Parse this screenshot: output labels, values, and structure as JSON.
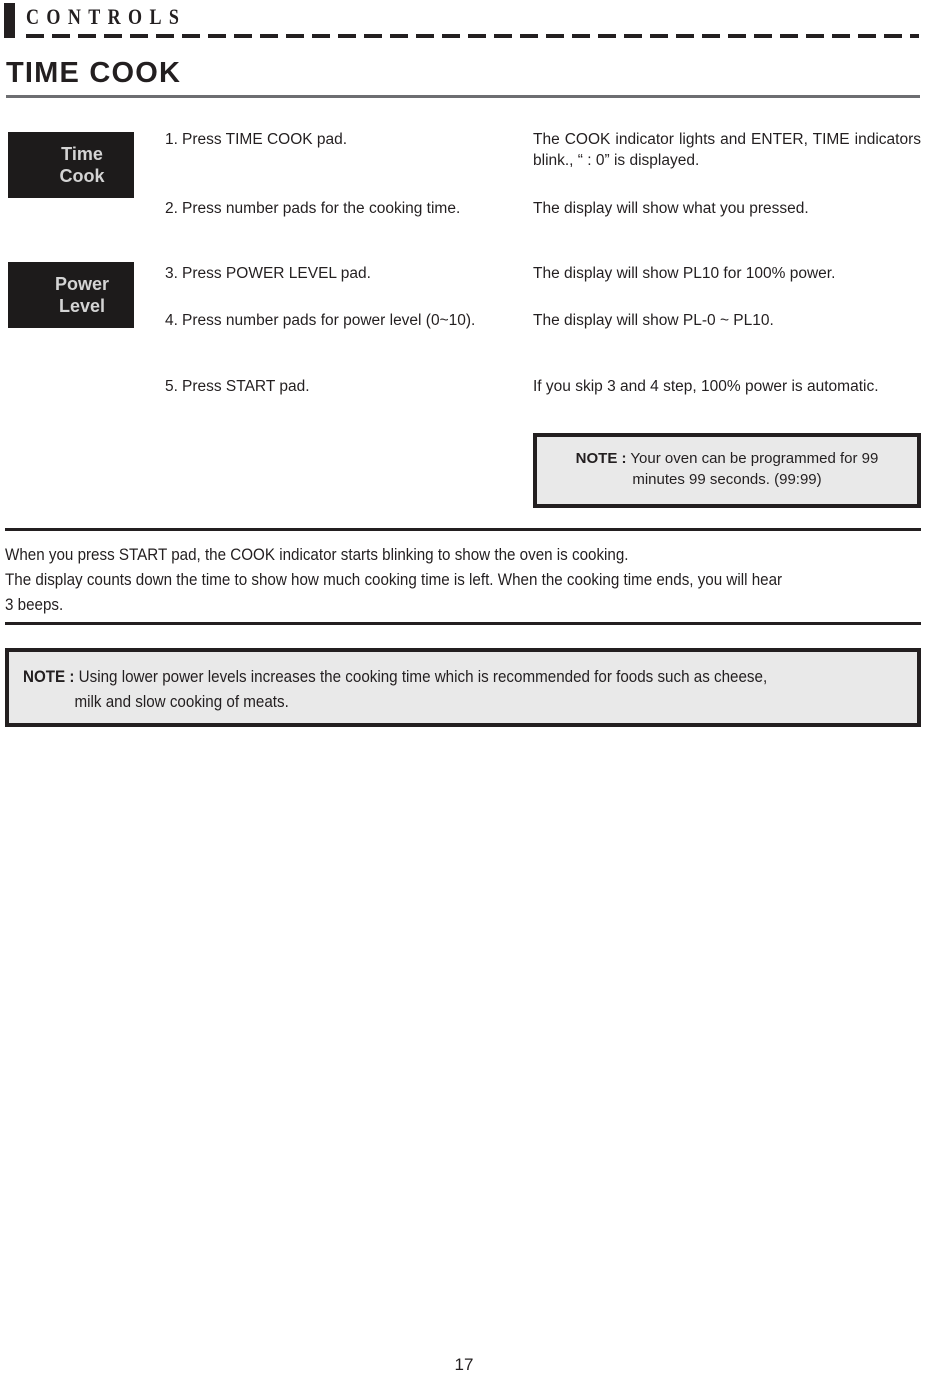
{
  "header": {
    "running_title": "CONTROLS",
    "section_title": "TIME COOK"
  },
  "pads": [
    {
      "name": "time-cook",
      "line1": "Time",
      "line2": "Cook"
    },
    {
      "name": "power-level",
      "line1": "Power",
      "line2": "Level"
    }
  ],
  "steps": [
    {
      "number": "1.",
      "action": "Press TIME COOK pad.",
      "result": "The COOK indicator lights and ENTER, TIME indicators blink., “ : 0” is displayed."
    },
    {
      "number": "2.",
      "action": "Press number pads for the cooking time.",
      "result": "The display will show what you pressed."
    },
    {
      "number": "3.",
      "action": "Press POWER LEVEL pad.",
      "result": "The display will show PL10 for 100% power."
    },
    {
      "number": "4.",
      "action": "Press number pads for power level (0~10).",
      "result": "The display will show PL-0 ~ PL10."
    },
    {
      "number": "5.",
      "action": "Press START pad.",
      "result": "If you skip 3 and 4 step, 100% power is automatic."
    }
  ],
  "note_top": {
    "label": "NOTE :",
    "text": "Your oven can be programmed for 99 minutes 99 seconds. (99:99)"
  },
  "body_paragraph": {
    "line1": "When you press START pad, the COOK indicator starts blinking to show the oven is cooking.",
    "line2": "The display counts down the time to show how much cooking time is left. When the cooking time ends, you will hear",
    "line3": "3 beeps."
  },
  "note_bottom": {
    "label": "NOTE :",
    "text_line1": "Using lower power levels increases the cooking time which is recommended for foods such as cheese,",
    "text_line2": "milk and slow cooking of meats."
  },
  "page_number": "17",
  "colors": {
    "ink": "#231f20",
    "pad_fill": "#1d1b1b",
    "pad_text": "#d4d4d4",
    "note_fill": "#e9e9e9",
    "section_rule": "#6d6e71"
  }
}
